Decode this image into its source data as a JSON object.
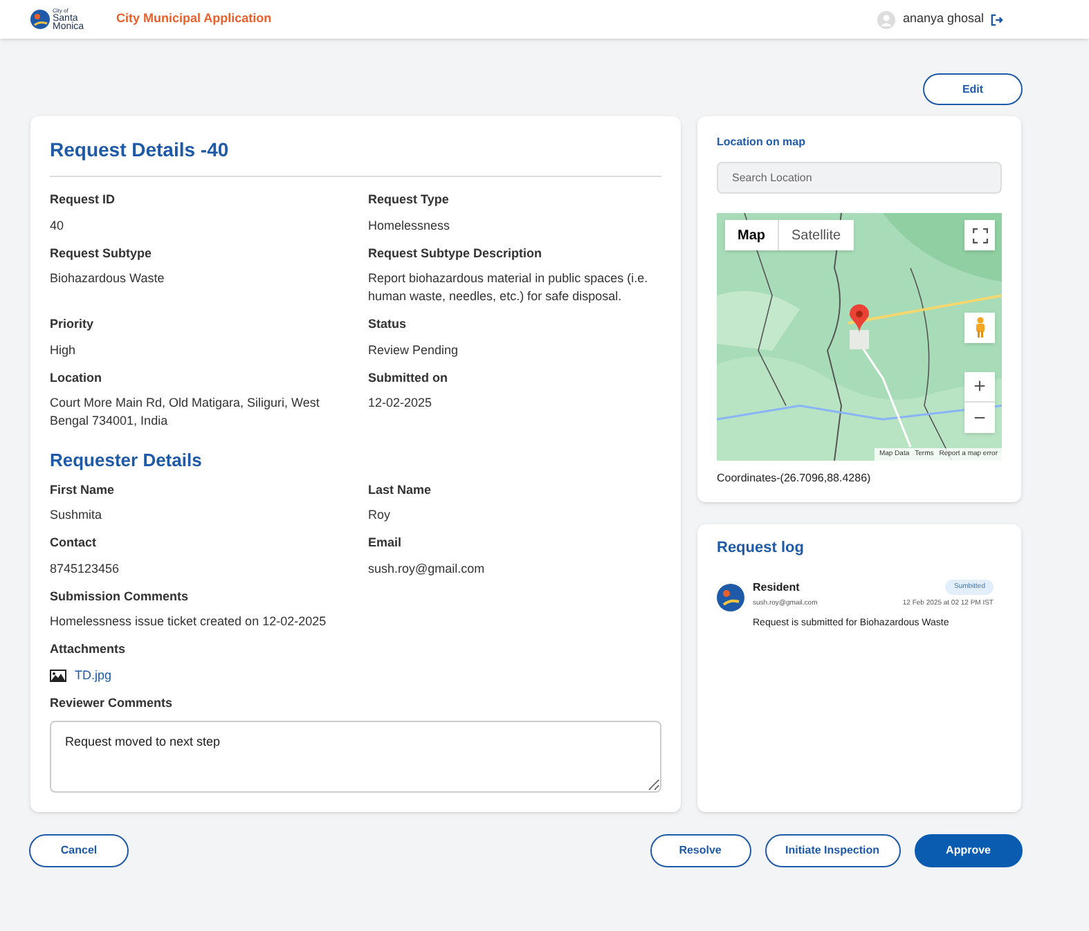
{
  "header": {
    "logo": {
      "line_1": "City of",
      "line_2": "Santa",
      "line_3": "Monica"
    },
    "app_title": "City Municipal Application",
    "user": "ananya ghosal"
  },
  "edit_button": "Edit",
  "request_details": {
    "title": "Request Details -40",
    "fields": [
      {
        "label": "Request ID",
        "value": "40"
      },
      {
        "label": "Request Type",
        "value": "Homelessness"
      },
      {
        "label": "Request Subtype",
        "value": "Biohazardous Waste"
      },
      {
        "label": "Request Subtype Description",
        "value": "Report biohazardous material in public spaces (i.e. human waste, needles, etc.) for safe disposal."
      },
      {
        "label": "Priority",
        "value": "High"
      },
      {
        "label": "Status",
        "value": "Review Pending"
      },
      {
        "label": "Location",
        "value": "Court More Main Rd, Old Matigara, Siliguri, West Bengal 734001, India"
      },
      {
        "label": "Submitted on",
        "value": "12-02-2025"
      }
    ]
  },
  "requester_details": {
    "title": "Requester Details",
    "fields": [
      {
        "label": "First Name",
        "value": "Sushmita"
      },
      {
        "label": "Last Name",
        "value": "Roy"
      },
      {
        "label": "Contact",
        "value": "8745123456"
      },
      {
        "label": "Email",
        "value": "sush.roy@gmail.com"
      }
    ],
    "submission_comments": {
      "label": "Submission Comments",
      "value": "Homelessness issue ticket created on 12-02-2025"
    },
    "attachments": {
      "label": "Attachments",
      "files": [
        "TD.jpg"
      ]
    },
    "reviewer_comments": {
      "label": "Reviewer Comments",
      "value": "Request moved to next step"
    }
  },
  "location": {
    "title": "Location on map",
    "search": {
      "placeholder": "Search Location"
    },
    "map": {
      "kind": "picture",
      "tabs": [
        {
          "label": "Map",
          "selected": true
        },
        {
          "label": "Satellite",
          "selected": false
        }
      ],
      "zoom_in": "+",
      "zoom_out": "−",
      "footer": [
        "Map Data",
        "Terms",
        "Report a map error"
      ]
    },
    "coordinates": "Coordinates-(26.7096,88.4286)"
  },
  "request_log": {
    "title": "Request log",
    "entries": [
      {
        "role": "Resident",
        "email": "sush.roy@gmail.com",
        "status": "Sumbitted",
        "time": "12 Feb 2025 at 02 12 PM IST",
        "message": "Request is submitted for Biohazardous Waste"
      }
    ]
  },
  "actions": {
    "left": [
      "Cancel"
    ],
    "right": [
      {
        "label": "Resolve",
        "primary": false
      },
      {
        "label": "Initiate Inspection",
        "primary": false
      },
      {
        "label": "Approve",
        "primary": true
      }
    ]
  }
}
